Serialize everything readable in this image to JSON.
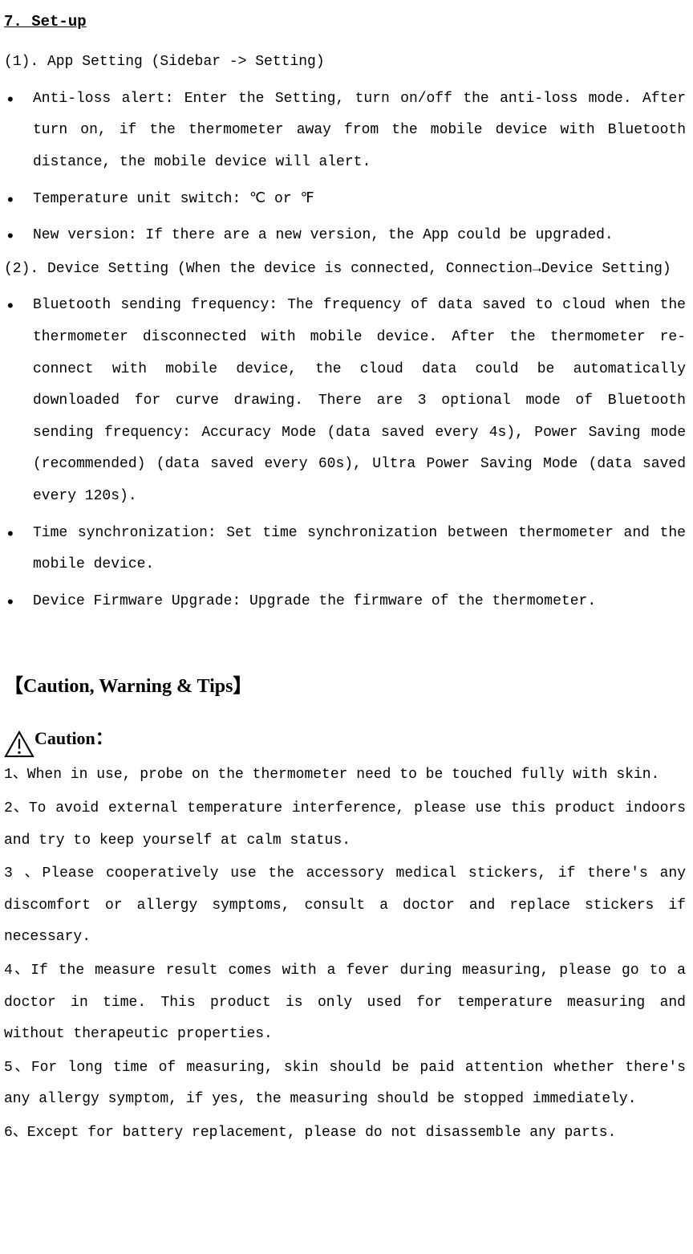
{
  "section": {
    "number_title": "7. Set-up",
    "sub1": "(1). App Setting (Sidebar -> Setting)",
    "bullets1": [
      "Anti-loss alert: Enter the Setting, turn on/off the anti-loss mode. After turn on, if the thermometer away from the mobile device with Bluetooth distance, the mobile device will alert.",
      "Temperature unit switch: ℃ or ℉",
      "New version: If there are a new version, the App could be upgraded."
    ],
    "sub2": "(2). Device Setting (When the device is connected, Connection→Device Setting)",
    "bullets2": [
      "Bluetooth sending frequency: The frequency of data saved to cloud when the thermometer disconnected with mobile device. After the thermometer re-connect with mobile device, the cloud data could be automatically downloaded for curve drawing. There are 3 optional mode of Bluetooth sending frequency: Accuracy Mode (data saved every 4s), Power Saving mode (recommended) (data saved every 60s), Ultra Power Saving Mode (data saved every 120s).",
      "Time  synchronization: Set time synchronization between thermometer and the mobile device.",
      "Device Firmware Upgrade: Upgrade the firmware of the thermometer."
    ]
  },
  "caution": {
    "main_heading": "【Caution, Warning & Tips】",
    "sub_heading": "Caution：",
    "items": [
      "1、When in use, probe on the thermometer need to be touched fully with skin.",
      "2、To avoid external temperature interference, please use this product indoors and try to keep yourself at calm status.",
      "3 、Please cooperatively use the accessory medical stickers, if there's any discomfort or allergy symptoms, consult a doctor and replace stickers if necessary.",
      "4、If the measure result comes with a fever during measuring, please go to a doctor in time. This product is only used for temperature measuring and without therapeutic properties.",
      "5、For long time of measuring, skin should be paid attention whether there's any allergy symptom, if yes, the measuring should be stopped immediately.",
      "6、Except for battery replacement, please do not disassemble any parts."
    ]
  }
}
